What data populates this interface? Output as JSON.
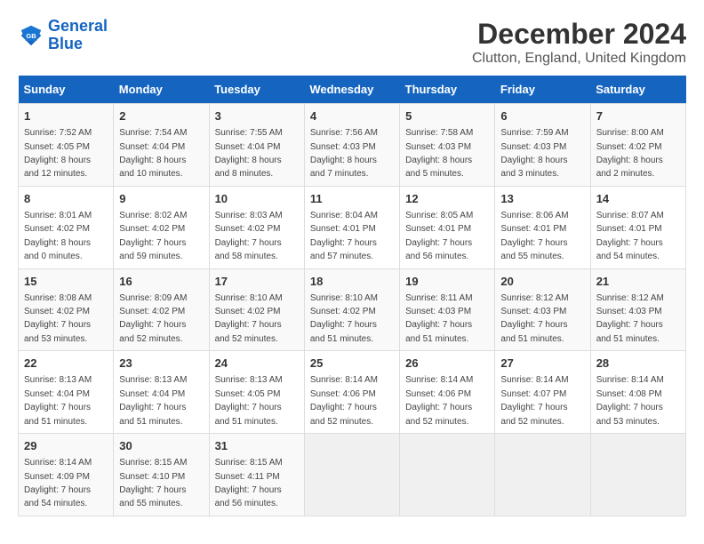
{
  "header": {
    "logo_line1": "General",
    "logo_line2": "Blue",
    "title": "December 2024",
    "subtitle": "Clutton, England, United Kingdom"
  },
  "days_of_week": [
    "Sunday",
    "Monday",
    "Tuesday",
    "Wednesday",
    "Thursday",
    "Friday",
    "Saturday"
  ],
  "weeks": [
    [
      {
        "day": "1",
        "info": "Sunrise: 7:52 AM\nSunset: 4:05 PM\nDaylight: 8 hours\nand 12 minutes."
      },
      {
        "day": "2",
        "info": "Sunrise: 7:54 AM\nSunset: 4:04 PM\nDaylight: 8 hours\nand 10 minutes."
      },
      {
        "day": "3",
        "info": "Sunrise: 7:55 AM\nSunset: 4:04 PM\nDaylight: 8 hours\nand 8 minutes."
      },
      {
        "day": "4",
        "info": "Sunrise: 7:56 AM\nSunset: 4:03 PM\nDaylight: 8 hours\nand 7 minutes."
      },
      {
        "day": "5",
        "info": "Sunrise: 7:58 AM\nSunset: 4:03 PM\nDaylight: 8 hours\nand 5 minutes."
      },
      {
        "day": "6",
        "info": "Sunrise: 7:59 AM\nSunset: 4:03 PM\nDaylight: 8 hours\nand 3 minutes."
      },
      {
        "day": "7",
        "info": "Sunrise: 8:00 AM\nSunset: 4:02 PM\nDaylight: 8 hours\nand 2 minutes."
      }
    ],
    [
      {
        "day": "8",
        "info": "Sunrise: 8:01 AM\nSunset: 4:02 PM\nDaylight: 8 hours\nand 0 minutes."
      },
      {
        "day": "9",
        "info": "Sunrise: 8:02 AM\nSunset: 4:02 PM\nDaylight: 7 hours\nand 59 minutes."
      },
      {
        "day": "10",
        "info": "Sunrise: 8:03 AM\nSunset: 4:02 PM\nDaylight: 7 hours\nand 58 minutes."
      },
      {
        "day": "11",
        "info": "Sunrise: 8:04 AM\nSunset: 4:01 PM\nDaylight: 7 hours\nand 57 minutes."
      },
      {
        "day": "12",
        "info": "Sunrise: 8:05 AM\nSunset: 4:01 PM\nDaylight: 7 hours\nand 56 minutes."
      },
      {
        "day": "13",
        "info": "Sunrise: 8:06 AM\nSunset: 4:01 PM\nDaylight: 7 hours\nand 55 minutes."
      },
      {
        "day": "14",
        "info": "Sunrise: 8:07 AM\nSunset: 4:01 PM\nDaylight: 7 hours\nand 54 minutes."
      }
    ],
    [
      {
        "day": "15",
        "info": "Sunrise: 8:08 AM\nSunset: 4:02 PM\nDaylight: 7 hours\nand 53 minutes."
      },
      {
        "day": "16",
        "info": "Sunrise: 8:09 AM\nSunset: 4:02 PM\nDaylight: 7 hours\nand 52 minutes."
      },
      {
        "day": "17",
        "info": "Sunrise: 8:10 AM\nSunset: 4:02 PM\nDaylight: 7 hours\nand 52 minutes."
      },
      {
        "day": "18",
        "info": "Sunrise: 8:10 AM\nSunset: 4:02 PM\nDaylight: 7 hours\nand 51 minutes."
      },
      {
        "day": "19",
        "info": "Sunrise: 8:11 AM\nSunset: 4:03 PM\nDaylight: 7 hours\nand 51 minutes."
      },
      {
        "day": "20",
        "info": "Sunrise: 8:12 AM\nSunset: 4:03 PM\nDaylight: 7 hours\nand 51 minutes."
      },
      {
        "day": "21",
        "info": "Sunrise: 8:12 AM\nSunset: 4:03 PM\nDaylight: 7 hours\nand 51 minutes."
      }
    ],
    [
      {
        "day": "22",
        "info": "Sunrise: 8:13 AM\nSunset: 4:04 PM\nDaylight: 7 hours\nand 51 minutes."
      },
      {
        "day": "23",
        "info": "Sunrise: 8:13 AM\nSunset: 4:04 PM\nDaylight: 7 hours\nand 51 minutes."
      },
      {
        "day": "24",
        "info": "Sunrise: 8:13 AM\nSunset: 4:05 PM\nDaylight: 7 hours\nand 51 minutes."
      },
      {
        "day": "25",
        "info": "Sunrise: 8:14 AM\nSunset: 4:06 PM\nDaylight: 7 hours\nand 52 minutes."
      },
      {
        "day": "26",
        "info": "Sunrise: 8:14 AM\nSunset: 4:06 PM\nDaylight: 7 hours\nand 52 minutes."
      },
      {
        "day": "27",
        "info": "Sunrise: 8:14 AM\nSunset: 4:07 PM\nDaylight: 7 hours\nand 52 minutes."
      },
      {
        "day": "28",
        "info": "Sunrise: 8:14 AM\nSunset: 4:08 PM\nDaylight: 7 hours\nand 53 minutes."
      }
    ],
    [
      {
        "day": "29",
        "info": "Sunrise: 8:14 AM\nSunset: 4:09 PM\nDaylight: 7 hours\nand 54 minutes."
      },
      {
        "day": "30",
        "info": "Sunrise: 8:15 AM\nSunset: 4:10 PM\nDaylight: 7 hours\nand 55 minutes."
      },
      {
        "day": "31",
        "info": "Sunrise: 8:15 AM\nSunset: 4:11 PM\nDaylight: 7 hours\nand 56 minutes."
      },
      null,
      null,
      null,
      null
    ]
  ]
}
